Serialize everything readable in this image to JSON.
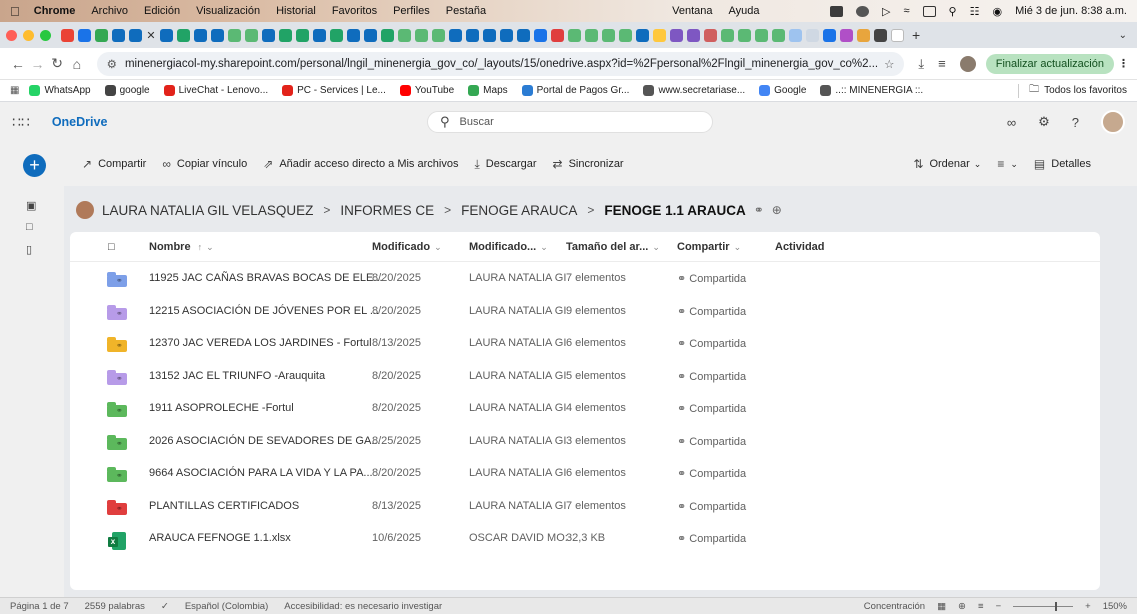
{
  "macbar": {
    "app": "Chrome",
    "menus": [
      "Archivo",
      "Edición",
      "Visualización",
      "Historial",
      "Favoritos",
      "Perfiles",
      "Pestaña",
      "Ventana",
      "Ayuda"
    ],
    "clock": "Mié 3 de jun.  8:38 a.m."
  },
  "browser": {
    "url": "minenergiacol-my.sharepoint.com/personal/lngil_minenergia_gov_co/_layouts/15/onedrive.aspx?id=%2Fpersonal%2Flngil_minenergia_gov_co%2...",
    "update_button": "Finalizar actualización",
    "bookmarks": [
      "WhatsApp",
      "google",
      "LiveChat - Lenovo...",
      "PC - Services | Le...",
      "YouTube",
      "Maps",
      "Portal de Pagos Gr...",
      "www.secretariase...",
      "Google",
      "..:: MINENERGIA ::."
    ],
    "bookmark_colors": [
      "#25d366",
      "#444444",
      "#e2231a",
      "#e2231a",
      "#ff0000",
      "#34a853",
      "#2b7cd3",
      "#555555",
      "#4285f4",
      "#555555"
    ],
    "all_bookmarks": "Todos los favoritos"
  },
  "onedrive": {
    "title": "OneDrive",
    "search_placeholder": "Buscar"
  },
  "commands": {
    "share": "Compartir",
    "copy_link": "Copiar vínculo",
    "add_shortcut": "Añadir acceso directo a Mis archivos",
    "download": "Descargar",
    "sync": "Sincronizar",
    "sort": "Ordenar",
    "details": "Detalles"
  },
  "breadcrumb": [
    "LAURA NATALIA GIL VELASQUEZ",
    "INFORMES CE",
    "FENOGE ARAUCA",
    "FENOGE 1.1 ARAUCA"
  ],
  "columns": {
    "name": "Nombre",
    "name_sort": "↑",
    "modified": "Modificado",
    "modified_by": "Modificado...",
    "size": "Tamaño del ar...",
    "sharing": "Compartir",
    "activity": "Actividad"
  },
  "files": [
    {
      "name": "11925 JAC CAÑAS BRAVAS BOCAS DE ELE...",
      "modified": "8/20/2025",
      "modified_by": "LAURA NATALIA GI",
      "size": "7 elementos",
      "sharing": "Compartida",
      "type": "folder",
      "color": "#7d9fe8"
    },
    {
      "name": "12215 ASOCIACIÓN DE JÓVENES POR EL ...",
      "modified": "8/20/2025",
      "modified_by": "LAURA NATALIA GI",
      "size": "9 elementos",
      "sharing": "Compartida",
      "type": "folder",
      "color": "#b79be8"
    },
    {
      "name": "12370 JAC VEREDA LOS JARDINES - Fortul",
      "modified": "8/13/2025",
      "modified_by": "LAURA NATALIA GI",
      "size": "6 elementos",
      "sharing": "Compartida",
      "type": "folder",
      "color": "#f0b429"
    },
    {
      "name": "13152 JAC EL TRIUNFO -Arauquita",
      "modified": "8/20/2025",
      "modified_by": "LAURA NATALIA GI",
      "size": "5 elementos",
      "sharing": "Compartida",
      "type": "folder",
      "color": "#b79be8"
    },
    {
      "name": "1911 ASOPROLECHE -Fortul",
      "modified": "8/20/2025",
      "modified_by": "LAURA NATALIA GI",
      "size": "4 elementos",
      "sharing": "Compartida",
      "type": "folder",
      "color": "#5cb85c"
    },
    {
      "name": "2026 ASOCIACIÓN DE SEVADORES DE GA...",
      "modified": "8/25/2025",
      "modified_by": "LAURA NATALIA GI",
      "size": "3 elementos",
      "sharing": "Compartida",
      "type": "folder",
      "color": "#5cb85c"
    },
    {
      "name": "9664 ASOCIACIÓN PARA LA VIDA Y LA PA...",
      "modified": "8/20/2025",
      "modified_by": "LAURA NATALIA GI",
      "size": "6 elementos",
      "sharing": "Compartida",
      "type": "folder",
      "color": "#5cb85c"
    },
    {
      "name": "PLANTILLAS CERTIFICADOS",
      "modified": "8/13/2025",
      "modified_by": "LAURA NATALIA GI",
      "size": "7 elementos",
      "sharing": "Compartida",
      "type": "folder",
      "color": "#e03e3e"
    },
    {
      "name": "ARAUCA FEFNOGE 1.1.xlsx",
      "modified": "10/6/2025",
      "modified_by": "OSCAR DAVID MO:",
      "size": "32,3 KB",
      "sharing": "Compartida",
      "type": "xlsx",
      "color": "#21a366"
    }
  ],
  "statusbar": {
    "page": "Página 1 de 7",
    "words": "2559 palabras",
    "language": "Español (Colombia)",
    "accessibility": "Accesibilidad: es necesario investigar",
    "focus": "Concentración",
    "zoom": "150%"
  }
}
